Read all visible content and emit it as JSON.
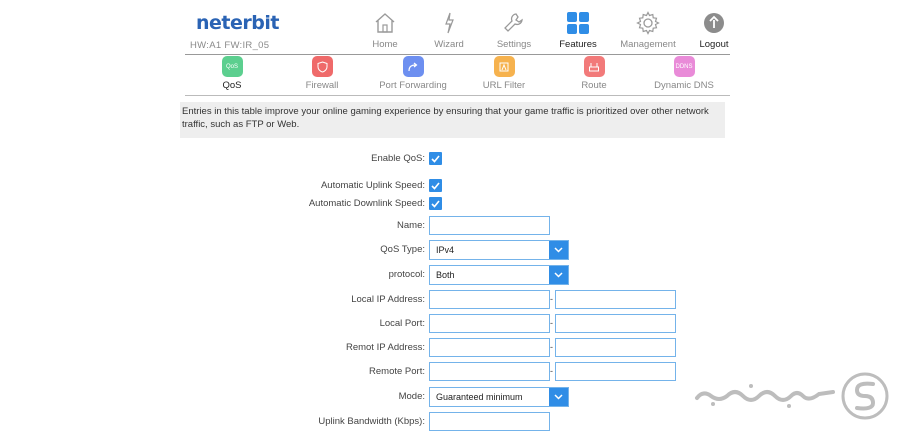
{
  "brand": {
    "logo": "neterbit",
    "hw_fw": "HW:A1 FW:IR_05"
  },
  "topnav": [
    {
      "label": "Home",
      "icon": "home-icon"
    },
    {
      "label": "Wizard",
      "icon": "wizard-icon"
    },
    {
      "label": "Settings",
      "icon": "wrench-icon"
    },
    {
      "label": "Features",
      "icon": "grid-icon",
      "active": true
    },
    {
      "label": "Management",
      "icon": "gear-icon"
    },
    {
      "label": "Logout",
      "icon": "logout-icon"
    }
  ],
  "subnav": [
    {
      "label": "QoS",
      "icon_text": "QoS",
      "color": "#5ccf8f",
      "active": true
    },
    {
      "label": "Firewall",
      "icon_text": "",
      "color": "#ef6a6a"
    },
    {
      "label": "Port Forwarding",
      "icon_text": "",
      "color": "#6d8ff0"
    },
    {
      "label": "URL Filter",
      "icon_text": "",
      "color": "#f6b24e"
    },
    {
      "label": "Route",
      "icon_text": "",
      "color": "#f27a7a"
    },
    {
      "label": "Dynamic DNS",
      "icon_text": "DDNS",
      "color": "#e98bd8"
    }
  ],
  "info_text": "Entries in this table improve your online gaming experience by ensuring that your game traffic is prioritized over other network traffic, such as FTP or Web.",
  "form": {
    "enable_qos": {
      "label": "Enable QoS:",
      "checked": true
    },
    "auto_uplink": {
      "label": "Automatic Uplink Speed:",
      "checked": true
    },
    "auto_downlink": {
      "label": "Automatic Downlink Speed:",
      "checked": true
    },
    "name": {
      "label": "Name:",
      "value": ""
    },
    "qos_type": {
      "label": "QoS Type:",
      "value": "IPv4"
    },
    "protocol": {
      "label": "protocol:",
      "value": "Both"
    },
    "local_ip": {
      "label": "Local IP Address:",
      "from": "",
      "to": ""
    },
    "local_port": {
      "label": "Local Port:",
      "from": "",
      "to": ""
    },
    "remote_ip": {
      "label": "Remot IP Address:",
      "from": "",
      "to": ""
    },
    "remote_port": {
      "label": "Remote Port:",
      "from": "",
      "to": ""
    },
    "mode": {
      "label": "Mode:",
      "value": "Guaranteed minimum"
    },
    "uplink_bw": {
      "label": "Uplink Bandwidth (Kbps):",
      "value": ""
    },
    "range_separator": "-"
  },
  "colors": {
    "accent": "#2f8de6",
    "input_border": "#74b3ea",
    "brand": "#2a63b4"
  }
}
